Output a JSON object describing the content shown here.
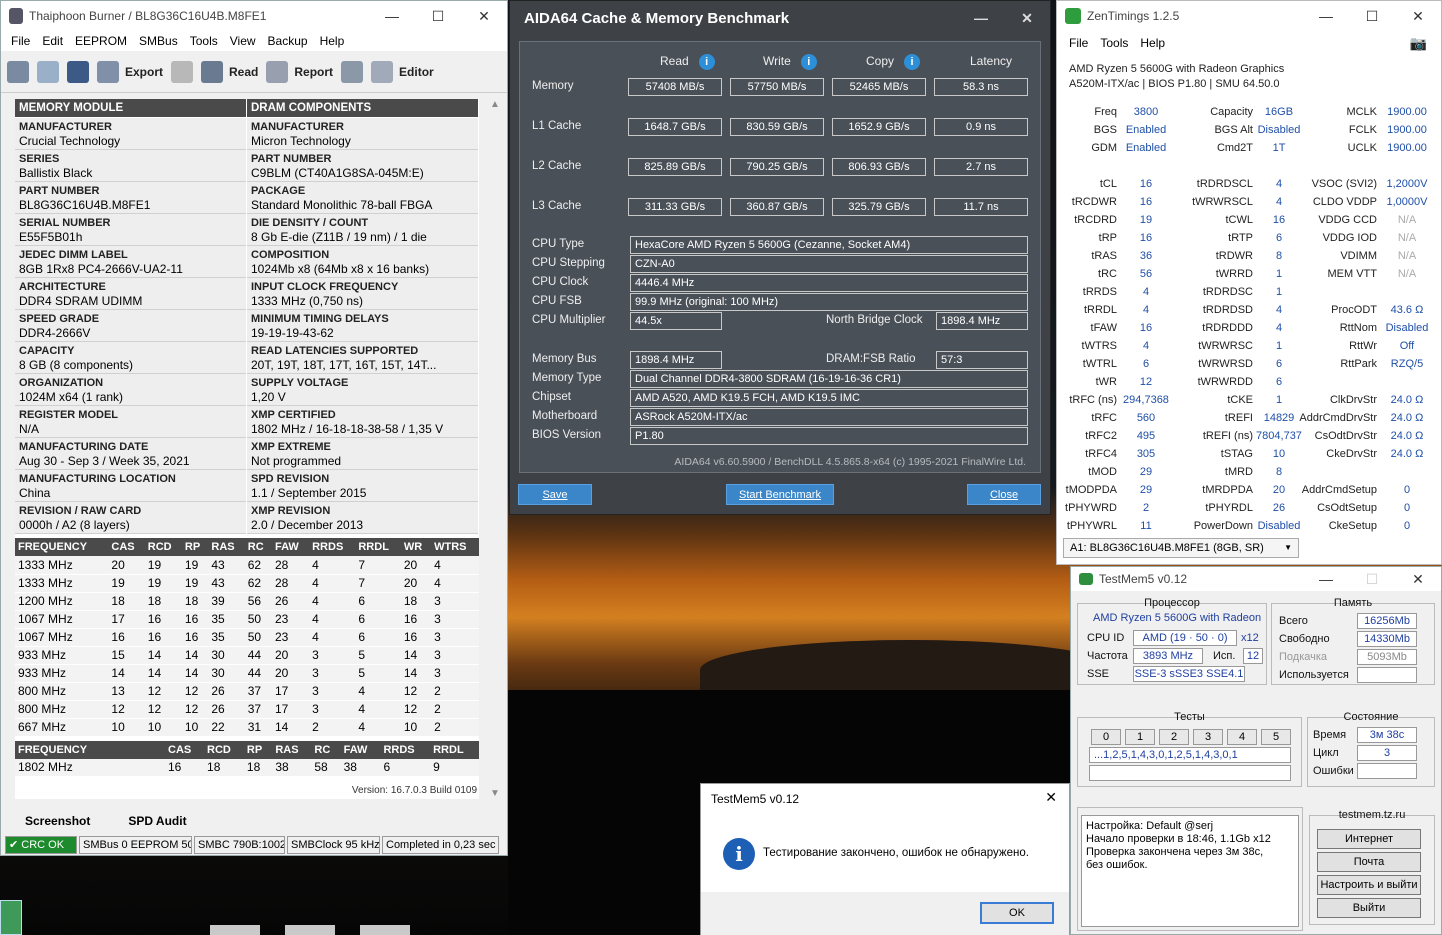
{
  "thaiphoon": {
    "title": "Thaiphoon Burner / BL8G36C16U4B.M8FE1",
    "menu": [
      "File",
      "Edit",
      "EEPROM",
      "SMBus",
      "Tools",
      "View",
      "Backup",
      "Help"
    ],
    "toolbar": {
      "export": "Export",
      "read": "Read",
      "report": "Report",
      "editor": "Editor"
    },
    "hdr_left": "MEMORY MODULE",
    "hdr_right": "DRAM COMPONENTS",
    "left": [
      {
        "k": "MANUFACTURER",
        "v": "Crucial Technology"
      },
      {
        "k": "SERIES",
        "v": "Ballistix Black"
      },
      {
        "k": "PART NUMBER",
        "v": "BL8G36C16U4B.M8FE1"
      },
      {
        "k": "SERIAL NUMBER",
        "v": "E55F5B01h"
      },
      {
        "k": "JEDEC DIMM LABEL",
        "v": "8GB 1Rx8 PC4-2666V-UA2-11"
      },
      {
        "k": "ARCHITECTURE",
        "v": "DDR4 SDRAM UDIMM"
      },
      {
        "k": "SPEED GRADE",
        "v": "DDR4-2666V"
      },
      {
        "k": "CAPACITY",
        "v": "8 GB (8 components)"
      },
      {
        "k": "ORGANIZATION",
        "v": "1024M x64 (1 rank)"
      },
      {
        "k": "REGISTER MODEL",
        "v": "N/A"
      },
      {
        "k": "MANUFACTURING DATE",
        "v": "Aug 30 - Sep 3 / Week 35, 2021"
      },
      {
        "k": "MANUFACTURING LOCATION",
        "v": "China"
      },
      {
        "k": "REVISION / RAW CARD",
        "v": "0000h / A2 (8 layers)"
      }
    ],
    "right": [
      {
        "k": "MANUFACTURER",
        "v": "Micron Technology"
      },
      {
        "k": "PART NUMBER",
        "v": "C9BLM (CT40A1G8SA-045M:E)"
      },
      {
        "k": "PACKAGE",
        "v": "Standard Monolithic 78-ball FBGA"
      },
      {
        "k": "DIE DENSITY / COUNT",
        "v": "8 Gb E-die (Z11B / 19 nm) / 1 die"
      },
      {
        "k": "COMPOSITION",
        "v": "1024Mb x8 (64Mb x8 x 16 banks)"
      },
      {
        "k": "INPUT CLOCK FREQUENCY",
        "v": "1333 MHz (0,750 ns)"
      },
      {
        "k": "MINIMUM TIMING DELAYS",
        "v": "19-19-19-43-62"
      },
      {
        "k": "READ LATENCIES SUPPORTED",
        "v": "20T, 19T, 18T, 17T, 16T, 15T, 14T..."
      },
      {
        "k": "SUPPLY VOLTAGE",
        "v": "1,20 V"
      },
      {
        "k": "XMP CERTIFIED",
        "v": "1802 MHz / 16-18-18-38-58 / 1,35 V"
      },
      {
        "k": "XMP EXTREME",
        "v": "Not programmed"
      },
      {
        "k": "SPD REVISION",
        "v": "1.1 / September 2015"
      },
      {
        "k": "XMP REVISION",
        "v": "2.0 / December 2013"
      }
    ],
    "freq_headers": [
      "FREQUENCY",
      "CAS",
      "RCD",
      "RP",
      "RAS",
      "RC",
      "FAW",
      "RRDS",
      "RRDL",
      "WR",
      "WTRS"
    ],
    "freq_rows": [
      [
        "1333 MHz",
        "20",
        "19",
        "19",
        "43",
        "62",
        "28",
        "4",
        "7",
        "20",
        "4"
      ],
      [
        "1333 MHz",
        "19",
        "19",
        "19",
        "43",
        "62",
        "28",
        "4",
        "7",
        "20",
        "4"
      ],
      [
        "1200 MHz",
        "18",
        "18",
        "18",
        "39",
        "56",
        "26",
        "4",
        "6",
        "18",
        "3"
      ],
      [
        "1067 MHz",
        "17",
        "16",
        "16",
        "35",
        "50",
        "23",
        "4",
        "6",
        "16",
        "3"
      ],
      [
        "1067 MHz",
        "16",
        "16",
        "16",
        "35",
        "50",
        "23",
        "4",
        "6",
        "16",
        "3"
      ],
      [
        "933 MHz",
        "15",
        "14",
        "14",
        "30",
        "44",
        "20",
        "3",
        "5",
        "14",
        "3"
      ],
      [
        "933 MHz",
        "14",
        "14",
        "14",
        "30",
        "44",
        "20",
        "3",
        "5",
        "14",
        "3"
      ],
      [
        "800 MHz",
        "13",
        "12",
        "12",
        "26",
        "37",
        "17",
        "3",
        "4",
        "12",
        "2"
      ],
      [
        "800 MHz",
        "12",
        "12",
        "12",
        "26",
        "37",
        "17",
        "3",
        "4",
        "12",
        "2"
      ],
      [
        "667 MHz",
        "10",
        "10",
        "10",
        "22",
        "31",
        "14",
        "2",
        "4",
        "10",
        "2"
      ]
    ],
    "xmp_headers": [
      "FREQUENCY",
      "CAS",
      "RCD",
      "RP",
      "RAS",
      "RC",
      "FAW",
      "RRDS",
      "RRDL"
    ],
    "xmp_row": [
      "1802 MHz",
      "16",
      "18",
      "18",
      "38",
      "58",
      "38",
      "6",
      "9"
    ],
    "version": "Version: 16.7.0.3 Build 0109",
    "tabs": [
      "Screenshot",
      "SPD Audit"
    ],
    "status": [
      "CRC OK",
      "SMBus 0 EEPROM 50h",
      "SMBC 790B:1002",
      "SMBClock 95 kHz",
      "Completed in 0,23 sec"
    ]
  },
  "aida": {
    "title": "AIDA64 Cache & Memory Benchmark",
    "cols": [
      "Read",
      "Write",
      "Copy",
      "Latency"
    ],
    "rows": [
      {
        "label": "Memory",
        "vals": [
          "57408 MB/s",
          "57750 MB/s",
          "52465 MB/s",
          "58.3 ns"
        ]
      },
      {
        "label": "L1 Cache",
        "vals": [
          "1648.7 GB/s",
          "830.59 GB/s",
          "1652.9 GB/s",
          "0.9 ns"
        ]
      },
      {
        "label": "L2 Cache",
        "vals": [
          "825.89 GB/s",
          "790.25 GB/s",
          "806.93 GB/s",
          "2.7 ns"
        ]
      },
      {
        "label": "L3 Cache",
        "vals": [
          "311.33 GB/s",
          "360.87 GB/s",
          "325.79 GB/s",
          "11.7 ns"
        ]
      }
    ],
    "info": [
      {
        "label": "CPU Type",
        "val": "HexaCore AMD Ryzen 5 5600G  (Cezanne, Socket AM4)"
      },
      {
        "label": "CPU Stepping",
        "val": "CZN-A0"
      },
      {
        "label": "CPU Clock",
        "val": "4446.4 MHz"
      },
      {
        "label": "CPU FSB",
        "val": "99.9 MHz  (original: 100 MHz)"
      },
      {
        "label": "CPU Multiplier",
        "val": "44.5x"
      }
    ],
    "nb_label": "North Bridge Clock",
    "nb_val": "1898.4 MHz",
    "info2": [
      {
        "label": "Memory Bus",
        "val": "1898.4 MHz"
      },
      {
        "label": "Memory Type",
        "val": "Dual Channel DDR4-3800 SDRAM  (16-19-16-36 CR1)"
      },
      {
        "label": "Chipset",
        "val": "AMD A520, AMD K19.5 FCH, AMD K19.5 IMC"
      },
      {
        "label": "Motherboard",
        "val": "ASRock A520M-ITX/ac"
      },
      {
        "label": "BIOS Version",
        "val": "P1.80"
      }
    ],
    "ratio_label": "DRAM:FSB Ratio",
    "ratio_val": "57:3",
    "footer": "AIDA64 v6.60.5900 / BenchDLL 4.5.865.8-x64  (c) 1995-2021 FinalWire Ltd.",
    "btn_save": "Save",
    "btn_start": "Start Benchmark",
    "btn_close": "Close"
  },
  "zen": {
    "title": "ZenTimings 1.2.5",
    "menu": [
      "File",
      "Tools",
      "Help"
    ],
    "cpu": "AMD Ryzen 5 5600G with Radeon Graphics",
    "board": "A520M-ITX/ac | BIOS P1.80 | SMU 64.50.0",
    "col1": [
      [
        "Freq",
        "3800"
      ],
      [
        "BGS",
        "Enabled"
      ],
      [
        "GDM",
        "Enabled"
      ],
      [
        "",
        ""
      ],
      [
        "tCL",
        "16"
      ],
      [
        "tRCDWR",
        "16"
      ],
      [
        "tRCDRD",
        "19"
      ],
      [
        "tRP",
        "16"
      ],
      [
        "tRAS",
        "36"
      ],
      [
        "tRC",
        "56"
      ],
      [
        "tRRDS",
        "4"
      ],
      [
        "tRRDL",
        "4"
      ],
      [
        "tFAW",
        "16"
      ],
      [
        "tWTRS",
        "4"
      ],
      [
        "tWTRL",
        "6"
      ],
      [
        "tWR",
        "12"
      ],
      [
        "tRFC (ns)",
        "294,7368"
      ],
      [
        "tRFC",
        "560"
      ],
      [
        "tRFC2",
        "495"
      ],
      [
        "tRFC4",
        "305"
      ],
      [
        "tMOD",
        "29"
      ],
      [
        "tMODPDA",
        "29"
      ],
      [
        "tPHYWRD",
        "2"
      ],
      [
        "tPHYWRL",
        "11"
      ]
    ],
    "col2": [
      [
        "Capacity",
        "16GB"
      ],
      [
        "BGS Alt",
        "Disabled"
      ],
      [
        "Cmd2T",
        "1T"
      ],
      [
        "",
        ""
      ],
      [
        "tRDRDSCL",
        "4"
      ],
      [
        "tWRWRSCL",
        "4"
      ],
      [
        "tCWL",
        "16"
      ],
      [
        "tRTP",
        "6"
      ],
      [
        "tRDWR",
        "8"
      ],
      [
        "tWRRD",
        "1"
      ],
      [
        "tRDRDSC",
        "1"
      ],
      [
        "tRDRDSD",
        "4"
      ],
      [
        "tRDRDDD",
        "4"
      ],
      [
        "tWRWRSC",
        "1"
      ],
      [
        "tWRWRSD",
        "6"
      ],
      [
        "tWRWRDD",
        "6"
      ],
      [
        "tCKE",
        "1"
      ],
      [
        "tREFI",
        "14829"
      ],
      [
        "tREFI (ns)",
        "7804,737"
      ],
      [
        "tSTAG",
        "10"
      ],
      [
        "tMRD",
        "8"
      ],
      [
        "tMRDPDA",
        "20"
      ],
      [
        "tPHYRDL",
        "26"
      ],
      [
        "PowerDown",
        "Disabled"
      ]
    ],
    "col3": [
      [
        "MCLK",
        "1900.00"
      ],
      [
        "FCLK",
        "1900.00"
      ],
      [
        "UCLK",
        "1900.00"
      ],
      [
        "",
        ""
      ],
      [
        "VSOC (SVI2)",
        "1,2000V"
      ],
      [
        "CLDO VDDP",
        "1,0000V"
      ],
      [
        "VDDG CCD",
        "N/A"
      ],
      [
        "VDDG IOD",
        "N/A"
      ],
      [
        "VDIMM",
        "N/A"
      ],
      [
        "MEM VTT",
        "N/A"
      ],
      [
        "",
        ""
      ],
      [
        "ProcODT",
        "43.6 Ω"
      ],
      [
        "RttNom",
        "Disabled"
      ],
      [
        "RttWr",
        "Off"
      ],
      [
        "RttPark",
        "RZQ/5"
      ],
      [
        "",
        ""
      ],
      [
        "ClkDrvStr",
        "24.0 Ω"
      ],
      [
        "AddrCmdDrvStr",
        "24.0 Ω"
      ],
      [
        "CsOdtDrvStr",
        "24.0 Ω"
      ],
      [
        "CkeDrvStr",
        "24.0 Ω"
      ],
      [
        "",
        ""
      ],
      [
        "AddrCmdSetup",
        "0"
      ],
      [
        "CsOdtSetup",
        "0"
      ],
      [
        "CkeSetup",
        "0"
      ]
    ],
    "dim_select": "A1: BL8G36C16U4B.M8FE1 (8GB, SR)"
  },
  "testmem": {
    "title": "TestMem5 v0.12",
    "proc_label": "Процессор",
    "proc_name": "AMD Ryzen 5 5600G with Radeon",
    "cpuid_label": "CPU ID",
    "cpuid_val": "AMD  (19 · 50 · 0)",
    "cpuid_x": "x12",
    "freq_label": "Частота",
    "freq_val": "3893 MHz",
    "isp_label": "Исп.",
    "isp_val": "12",
    "sse_label": "SSE",
    "sse_val": "SSE-3 sSSE3 SSE4.1",
    "mem_label": "Память",
    "total_label": "Всего",
    "total_val": "16256Mb",
    "free_label": "Свободно",
    "free_val": "14330Mb",
    "swap_label": "Подкачка",
    "swap_val": "5093Mb",
    "used_label": "Используется",
    "tests_label": "Тесты",
    "tests": [
      "0",
      "1",
      "2",
      "3",
      "4",
      "5"
    ],
    "seq": "...1,2,5,1,4,3,0,1,2,5,1,4,3,0,1",
    "state_label": "Состояние",
    "time_label": "Время",
    "time_val": "3м 38с",
    "cycle_label": "Цикл",
    "cycle_val": "3",
    "err_label": "Ошибки",
    "err_val": "",
    "log": "Настройка: Default @serj\nНачало проверки в 18:46, 1.1Gb x12\nПроверка закончена через 3м 38с,\nбез ошибок.",
    "site": "testmem.tz.ru",
    "btn_internet": "Интернет",
    "btn_mail": "Почта",
    "btn_config": "Настроить и выйти",
    "btn_exit": "Выйти"
  },
  "dialog": {
    "title": "TestMem5 v0.12",
    "message": "Тестирование закончено, ошибок не обнаружено.",
    "ok": "OK"
  }
}
